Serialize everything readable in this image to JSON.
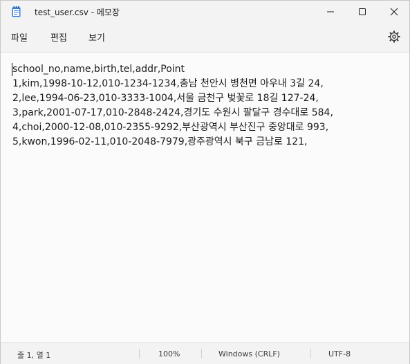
{
  "window": {
    "title": "test_user.csv - 메모장"
  },
  "menu": {
    "file": "파일",
    "edit": "편집",
    "view": "보기"
  },
  "editor": {
    "lines": [
      "school_no,name,birth,tel,addr,Point",
      "1,kim,1998-10-12,010-1234-1234,충남 천안시 병천면 아우내 3길 24,",
      "2,lee,1994-06-23,010-3333-1004,서울 금천구 벚꽃로 18길 127-24,",
      "3,park,2001-07-17,010-2848-2424,경기도 수원시 팔달구 경수대로 584,",
      "4,choi,2000-12-08,010-2355-9292,부산광역시 부산진구 중앙대로 993,",
      "5,kwon,1996-02-11,010-2048-7979,광주광역시 북구 금남로 121,"
    ]
  },
  "status": {
    "position": "줄 1, 열 1",
    "zoom": "100%",
    "line_ending": "Windows (CRLF)",
    "encoding": "UTF-8"
  },
  "icons": {
    "app": "notepad-icon",
    "minimize": "minimize-icon",
    "maximize": "maximize-icon",
    "close": "close-icon",
    "settings": "gear-icon"
  },
  "colors": {
    "accent": "#1a73e8",
    "background": "#f3f3f3",
    "editor_background": "#fbfbfb"
  }
}
